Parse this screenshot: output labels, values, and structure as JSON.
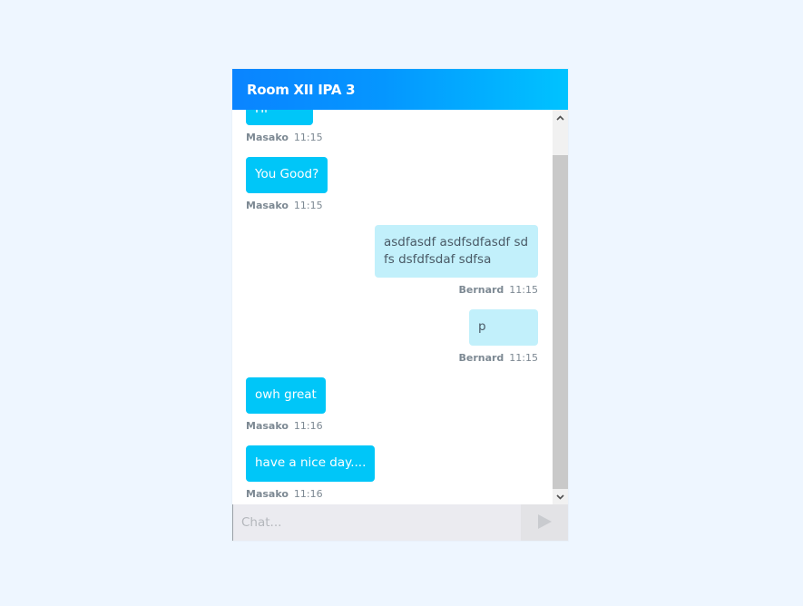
{
  "room": {
    "title": "Room XII IPA 3"
  },
  "messages": [
    {
      "direction": "in",
      "text": "Hi",
      "sender": "Masako",
      "time": "11:15"
    },
    {
      "direction": "in",
      "text": "You Good?",
      "sender": "Masako",
      "time": "11:15"
    },
    {
      "direction": "out",
      "text": "asdfasdf asdfsdfasdf sd fs dsfdfsdaf sdfsa",
      "sender": "Bernard",
      "time": "11:15"
    },
    {
      "direction": "out",
      "text": "p",
      "sender": "Bernard",
      "time": "11:15"
    },
    {
      "direction": "in",
      "text": "owh great",
      "sender": "Masako",
      "time": "11:16"
    },
    {
      "direction": "in",
      "text": "have a nice day....",
      "sender": "Masako",
      "time": "11:16"
    }
  ],
  "composer": {
    "placeholder": "Chat...",
    "value": ""
  },
  "icons": {
    "send": "send-icon",
    "scroll_up": "chevron-up-icon",
    "scroll_down": "chevron-down-icon"
  },
  "colors": {
    "header_start": "#0a84ff",
    "header_end": "#00c3ff",
    "incoming_bubble": "#00c6f8",
    "outgoing_bubble": "#c2f0fb",
    "page_background": "#eef6ff"
  }
}
